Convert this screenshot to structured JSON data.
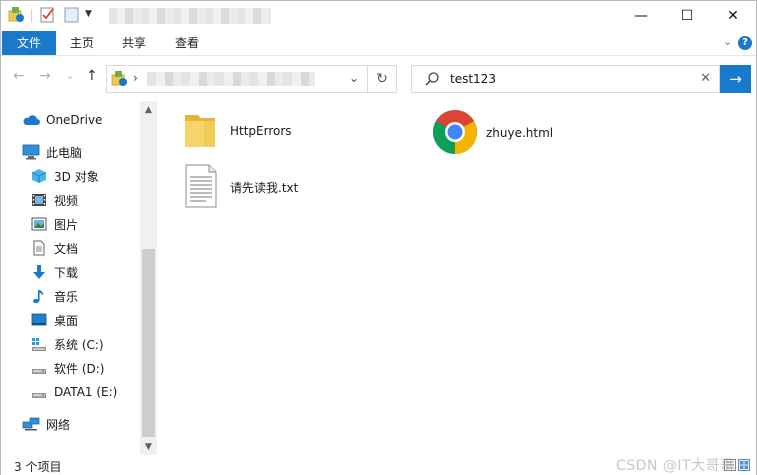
{
  "window": {
    "title_controls": {
      "minimize": "—",
      "maximize": "☐",
      "close": "✕"
    }
  },
  "ribbon": {
    "tabs": [
      {
        "label": "文件",
        "active": true
      },
      {
        "label": "主页"
      },
      {
        "label": "共享"
      },
      {
        "label": "查看"
      }
    ],
    "expand_glyph": "⌄",
    "help_glyph": "?"
  },
  "address": {
    "back_glyph": "←",
    "forward_glyph": "→",
    "recent_glyph": "⌄",
    "up_glyph": "↑",
    "path_chevron": "›",
    "dropdown_glyph": "⌄",
    "refresh_glyph": "↻"
  },
  "search": {
    "value": "test123",
    "clear_glyph": "✕",
    "go_glyph": "→"
  },
  "navigation": {
    "items": [
      {
        "label": "OneDrive",
        "icon": "cloud-icon",
        "level": 0
      },
      {
        "label": "此电脑",
        "icon": "computer-icon",
        "level": 0
      },
      {
        "label": "3D 对象",
        "icon": "cube-icon",
        "level": 1
      },
      {
        "label": "视频",
        "icon": "video-icon",
        "level": 1
      },
      {
        "label": "图片",
        "icon": "pictures-icon",
        "level": 1
      },
      {
        "label": "文档",
        "icon": "documents-icon",
        "level": 1
      },
      {
        "label": "下载",
        "icon": "download-icon",
        "level": 1
      },
      {
        "label": "音乐",
        "icon": "music-icon",
        "level": 1
      },
      {
        "label": "桌面",
        "icon": "desktop-icon",
        "level": 1
      },
      {
        "label": "系统 (C:)",
        "icon": "windows-drive-icon",
        "level": 1
      },
      {
        "label": "软件 (D:)",
        "icon": "drive-icon",
        "level": 1
      },
      {
        "label": "DATA1 (E:)",
        "icon": "drive-icon",
        "level": 1
      },
      {
        "label": "网络",
        "icon": "network-icon",
        "level": 0
      }
    ]
  },
  "files": [
    {
      "name": "HttpErrors",
      "icon": "folder-icon"
    },
    {
      "name": "zhuye.html",
      "icon": "chrome-icon"
    },
    {
      "name": "请先读我.txt",
      "icon": "text-file-icon"
    }
  ],
  "status": {
    "count_text": "3 个项目",
    "watermark": "CSDN @IT大哥哥"
  },
  "colors": {
    "accent": "#1979ca",
    "folder": "#f3c74f",
    "chrome_red": "#db4437",
    "chrome_green": "#0f9d58",
    "chrome_yellow": "#f4b400",
    "chrome_blue": "#4285f4"
  }
}
